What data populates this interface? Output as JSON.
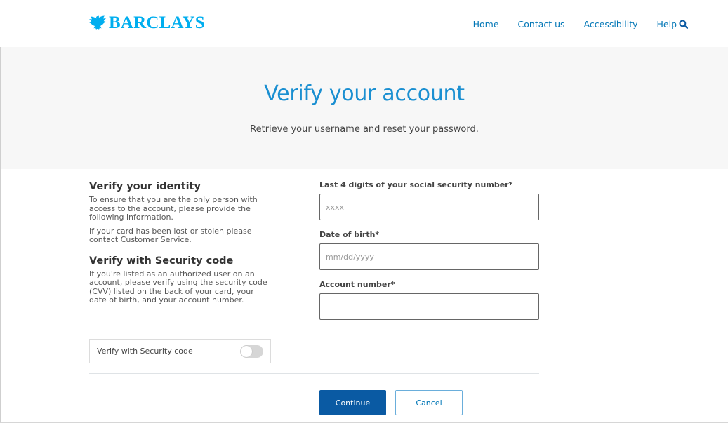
{
  "header": {
    "brand": "BARCLAYS",
    "nav": [
      {
        "label": "Home"
      },
      {
        "label": "Contact us"
      },
      {
        "label": "Accessibility"
      },
      {
        "label": "Help"
      }
    ],
    "search_icon": "search-icon"
  },
  "hero": {
    "title": "Verify your account",
    "subtitle": "Retrieve your username and reset your password."
  },
  "left": {
    "identity_heading": "Verify your identity",
    "identity_text_1": "To ensure that you are the only person with access to the account, please provide the following information.",
    "identity_text_2": "If your card has been lost or stolen please contact Customer Service.",
    "security_heading": "Verify with Security code",
    "security_text": "If you're listed as an authorized user on an account, please verify using the security code (CVV) listed on the back of your card, your date of birth, and your account number.",
    "toggle_label": "Verify with Security code",
    "toggle_on": false
  },
  "form": {
    "fields": [
      {
        "label": "Last 4 digits of your social security number*",
        "placeholder": "xxxx",
        "value": ""
      },
      {
        "label": "Date of birth*",
        "placeholder": "mm/dd/yyyy",
        "value": ""
      },
      {
        "label": "Account number*",
        "placeholder": "",
        "value": ""
      }
    ],
    "continue_label": "Continue",
    "cancel_label": "Cancel"
  },
  "colors": {
    "brand": "#00aeef",
    "link": "#0076b6",
    "title": "#1a8fd1",
    "primary_button": "#0a5aa3"
  }
}
